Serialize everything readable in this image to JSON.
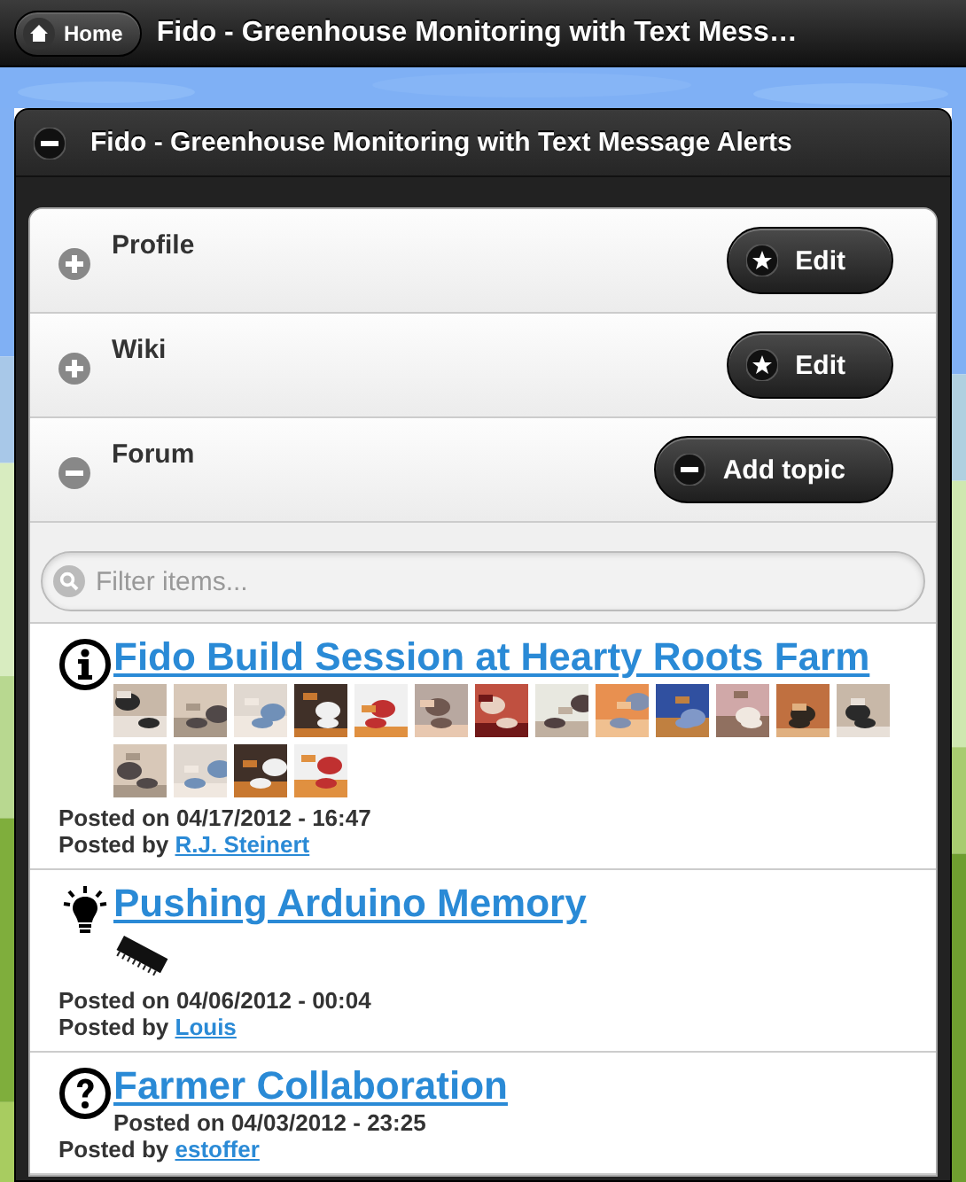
{
  "header": {
    "home_button": "Home",
    "title": "Fido - Greenhouse Monitoring with Text Mess…"
  },
  "panel": {
    "title": "Fido - Greenhouse Monitoring with Text Message Alerts",
    "expanded": true,
    "sections": [
      {
        "label": "Profile",
        "expanded": false,
        "button": {
          "label": "Edit",
          "kind": "star"
        }
      },
      {
        "label": "Wiki",
        "expanded": false,
        "button": {
          "label": "Edit",
          "kind": "star"
        }
      },
      {
        "label": "Forum",
        "expanded": true,
        "button": {
          "label": "Add topic",
          "kind": "minus"
        }
      }
    ],
    "filter": {
      "placeholder": "Filter items..."
    },
    "posts": [
      {
        "kind": "info",
        "title": "Fido Build Session at Hearty Roots Farm",
        "posted_on": "Posted on 04/17/2012 - 16:47",
        "posted_by_label": "Posted by",
        "author": "R.J. Steinert"
      },
      {
        "kind": "idea",
        "title": "Pushing Arduino Memory",
        "images": [
          {
            "kind": "chip"
          }
        ],
        "posted_on": "Posted on 04/06/2012 - 00:04",
        "posted_by_label": "Posted by",
        "author": "Louis"
      },
      {
        "kind": "question",
        "title": "Farmer Collaboration",
        "posted_on": "Posted on 04/03/2012 - 23:25",
        "posted_by_label": "Posted by",
        "author": "estoffer"
      }
    ]
  }
}
